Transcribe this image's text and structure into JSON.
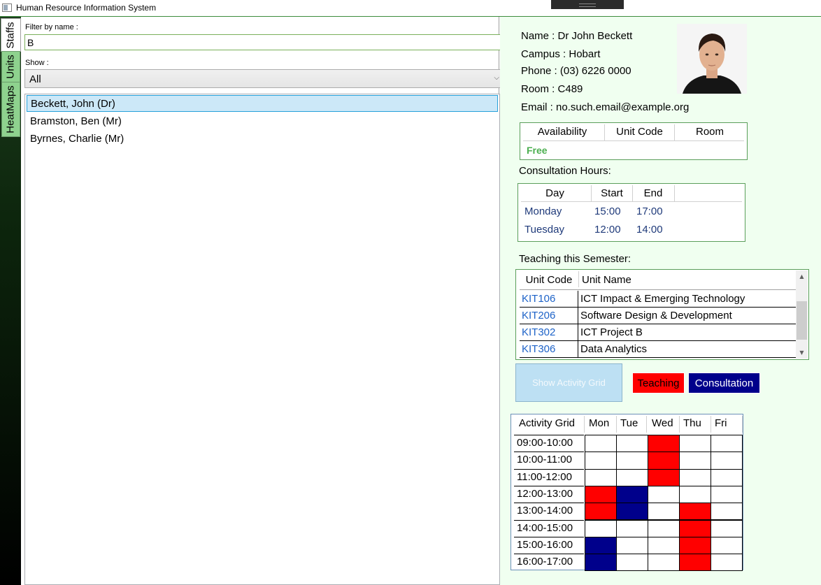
{
  "window": {
    "title": "Human Resource Information System"
  },
  "tabs": [
    {
      "label": "Staffs",
      "active": true
    },
    {
      "label": "Units",
      "active": false
    },
    {
      "label": "HeatMaps",
      "active": false
    }
  ],
  "filter": {
    "label": "Filter by name :",
    "value": "B"
  },
  "show": {
    "label": "Show :",
    "selected": "All"
  },
  "staff_list": [
    {
      "label": "Beckett, John (Dr)",
      "selected": true
    },
    {
      "label": "Bramston, Ben (Mr)",
      "selected": false
    },
    {
      "label": "Byrnes, Charlie (Mr)",
      "selected": false
    }
  ],
  "details": {
    "name_label": "Name :",
    "name_value": "Dr John Beckett",
    "campus_label": "Campus :",
    "campus_value": "Hobart",
    "phone_label": "Phone :",
    "phone_value": "(03) 6226 0000",
    "room_label": "Room :",
    "room_value": "C489",
    "email_label": "Email :",
    "email_value": "no.such.email@example.org"
  },
  "availability": {
    "headers": [
      "Availability",
      "Unit Code",
      "Room"
    ],
    "status": "Free",
    "status_color": "#4caf50"
  },
  "consultation": {
    "title": "Consultation Hours:",
    "headers": [
      "Day",
      "Start",
      "End"
    ],
    "rows": [
      {
        "day": "Monday",
        "start": "15:00",
        "end": "17:00"
      },
      {
        "day": "Tuesday",
        "start": "12:00",
        "end": "14:00"
      }
    ]
  },
  "teaching": {
    "title": "Teaching this Semester:",
    "headers": [
      "Unit Code",
      "Unit Name"
    ],
    "rows": [
      {
        "code": "KIT106",
        "name": "ICT Impact & Emerging Technology"
      },
      {
        "code": "KIT206",
        "name": "Software Design & Development"
      },
      {
        "code": "KIT302",
        "name": "ICT Project B"
      },
      {
        "code": "KIT306",
        "name": "Data Analytics"
      }
    ]
  },
  "activity_button": {
    "label": "Show Activity Grid"
  },
  "legend": {
    "teaching_label": "Teaching",
    "consultation_label": "Consultation",
    "teaching_color": "#ff0000",
    "consultation_color": "#00008b"
  },
  "activity_grid": {
    "headers": [
      "Activity Grid",
      "Mon",
      "Tue",
      "Wed",
      "Thu",
      "Fri"
    ],
    "times": [
      "09:00-10:00",
      "10:00-11:00",
      "11:00-12:00",
      "12:00-13:00",
      "13:00-14:00",
      "14:00-15:00",
      "15:00-16:00",
      "16:00-17:00"
    ],
    "cells": [
      [
        "",
        "",
        "T",
        "",
        ""
      ],
      [
        "",
        "",
        "T",
        "",
        ""
      ],
      [
        "",
        "",
        "T",
        "",
        ""
      ],
      [
        "T",
        "C",
        "",
        "",
        ""
      ],
      [
        "T",
        "C",
        "",
        "T",
        ""
      ],
      [
        "",
        "",
        "",
        "T",
        ""
      ],
      [
        "C",
        "",
        "",
        "T",
        ""
      ],
      [
        "C",
        "",
        "",
        "T",
        ""
      ]
    ]
  }
}
